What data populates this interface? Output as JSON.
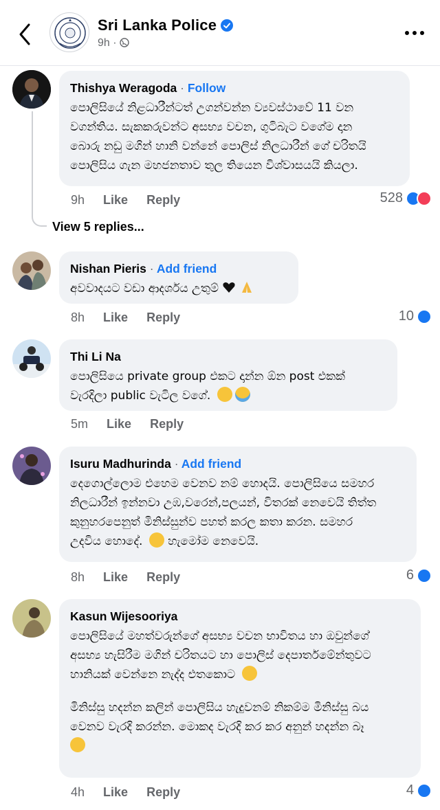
{
  "header": {
    "page_name": "Sri Lanka Police",
    "time": "9h ·"
  },
  "comments": [
    {
      "author": "Thishya Weragoda",
      "action_label": "Follow",
      "text": "පොලිසියේ නිළධාරීන්ටත් උගන්වන්න ව්‍යවස්ථාවේ 11 වන\nවගන්තිය. සැකකරුවන්ට අසභ්‍ය වචන, ගුටිබැට වගේම දාන\nබොරු නඩු මගින් හානි වන්නේ පොලිස් නිලධාරීන් ගේ චරිතයි\nපොලිසිය ගැන මහජනතාව තුල තියෙන විශ්වාසයයි කියලා.",
      "time": "9h",
      "like": "Like",
      "reply": "Reply",
      "reactions": "528"
    },
    {
      "author": "Nishan Pieris",
      "action_label": "Add friend",
      "text": "අවවාදයට වඩා ආදර්ශය උතුම්",
      "time": "8h",
      "like": "Like",
      "reply": "Reply",
      "reactions": "10"
    },
    {
      "author": "Thi Li Na",
      "action_label": "",
      "text": "පොලිසියෙ private group එකට දාන්න ඕන post එකක්\nවැරදිලා public වැටිල වගේ.",
      "time": "5m",
      "like": "Like",
      "reply": "Reply",
      "reactions": ""
    },
    {
      "author": "Isuru Madhurinda",
      "action_label": "Add friend",
      "text": "දෙගොල්ලොම එහෙම වෙනව නම් හොදයි. පොලිසියෙ සමහර\nනිලධාරීන් ඉන්නවා උඹ,වරෙන්,පලයන්, විතරක් නෙවෙයි තිත්ත\nකුනුහරපෙනුත් මිනිස්සුන්ව පහත් කරල කතා කරන. සමහර\nඋදවිය හොදේ.",
      "text_suffix": "හැමෝම නෙවෙයි.",
      "time": "8h",
      "like": "Like",
      "reply": "Reply",
      "reactions": "6"
    },
    {
      "author": "Kasun Wijesooriya",
      "action_label": "",
      "text": "පොලිසියේ මහත්වරුන්ගේ අසභ්‍ය වචන භාවිතය හා ඔවුන්ගේ\nඅසභ්‍ය හැසිරීම මගින් චරිතයට හා පොලිස් දෙපාර්තමේන්තුවට\nහානියක් වෙන්නෙ නැද්ද එතකොට",
      "text2": "මිනිස්සු හදන්න කලින් පොලිසිය හැදුවනම් නිකම්ම මිනිස්සු බය\nවෙනව වැරදි කරන්න. මොකද වැරදි කර කර අනුන් හදන්න බෑ",
      "time": "4h",
      "like": "Like",
      "reply": "Reply",
      "reactions": "4"
    }
  ],
  "view_replies": "View 5 replies...",
  "colors": {
    "link": "#1877f2",
    "bubble": "#f0f2f5",
    "secondary_text": "#65676b",
    "love": "#f33e58"
  }
}
